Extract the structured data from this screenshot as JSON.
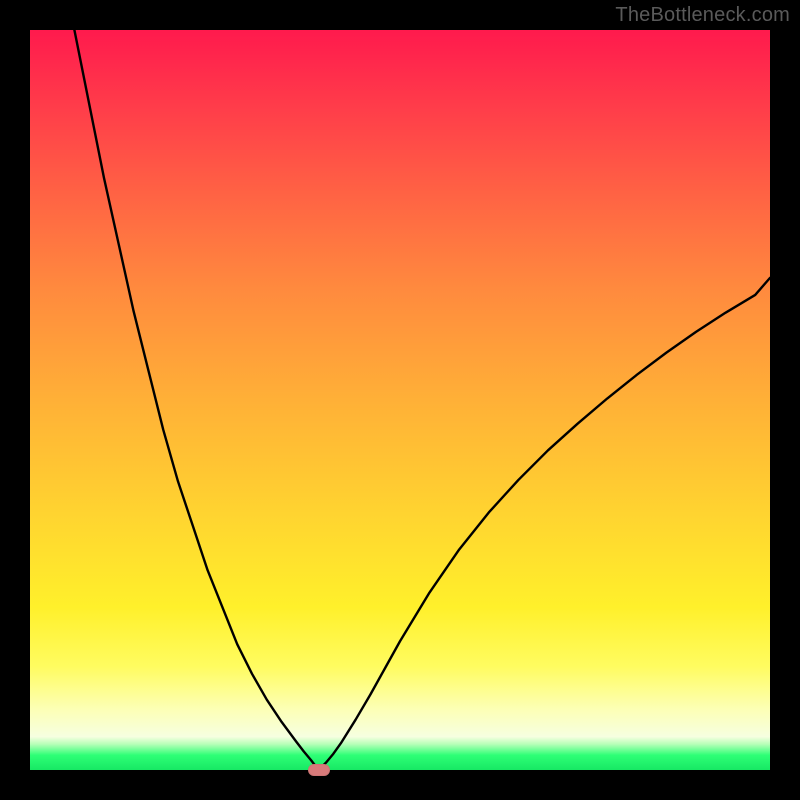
{
  "watermark": "TheBottleneck.com",
  "colors": {
    "frame": "#000000",
    "gradient_top": "#ff1a4d",
    "gradient_mid": "#ffd330",
    "gradient_low": "#fcffb8",
    "gradient_bottom": "#17e864",
    "curve": "#000000",
    "marker": "#d77a7a"
  },
  "chart_data": {
    "type": "line",
    "title": "",
    "xlabel": "",
    "ylabel": "",
    "xlim": [
      0,
      100
    ],
    "ylim": [
      0,
      100
    ],
    "grid": false,
    "legend": false,
    "notes": "V-shaped bottleneck curve; minimum (0%) near x≈39; left branch rises to 100% at x≈6; right branch rises to ≈67% at x=100. Marker sits at the minimum on the x-axis.",
    "x": [
      6,
      8,
      10,
      12,
      14,
      16,
      18,
      20,
      22,
      24,
      26,
      28,
      30,
      32,
      34,
      36,
      37,
      38,
      39,
      40,
      41,
      42,
      44,
      46,
      48,
      50,
      54,
      58,
      62,
      66,
      70,
      74,
      78,
      82,
      86,
      90,
      94,
      98,
      100
    ],
    "y": [
      100,
      90,
      80,
      71,
      62,
      54,
      46,
      39,
      33,
      27,
      22,
      17,
      13,
      9.5,
      6.5,
      3.8,
      2.5,
      1.3,
      0,
      1.0,
      2.2,
      3.6,
      6.8,
      10.2,
      13.8,
      17.4,
      24.0,
      29.8,
      34.8,
      39.2,
      43.2,
      46.8,
      50.2,
      53.4,
      56.4,
      59.2,
      61.8,
      64.2,
      66.5
    ],
    "marker": {
      "x": 39,
      "y": 0
    }
  }
}
